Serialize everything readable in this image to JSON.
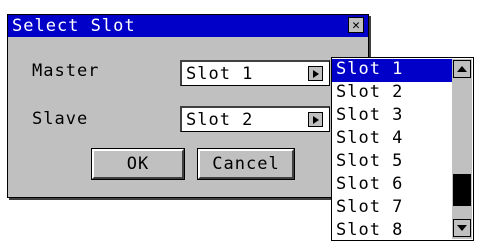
{
  "dialog": {
    "title": "Select Slot",
    "close_glyph": "✕",
    "master_label": "Master",
    "slave_label": "Slave",
    "master_value": "Slot 1",
    "slave_value": "Slot 2",
    "ok_label": "OK",
    "cancel_label": "Cancel"
  },
  "dropdown": {
    "items": [
      "Slot 1",
      "Slot 2",
      "Slot 3",
      "Slot 4",
      "Slot 5",
      "Slot 6",
      "Slot 7",
      "Slot 8"
    ],
    "selected_index": 0,
    "scroll_position": 0.9
  },
  "colors": {
    "title_bar": "#0000c8",
    "dialog_bg": "#c0c0c0",
    "selection": "#0000c8"
  }
}
